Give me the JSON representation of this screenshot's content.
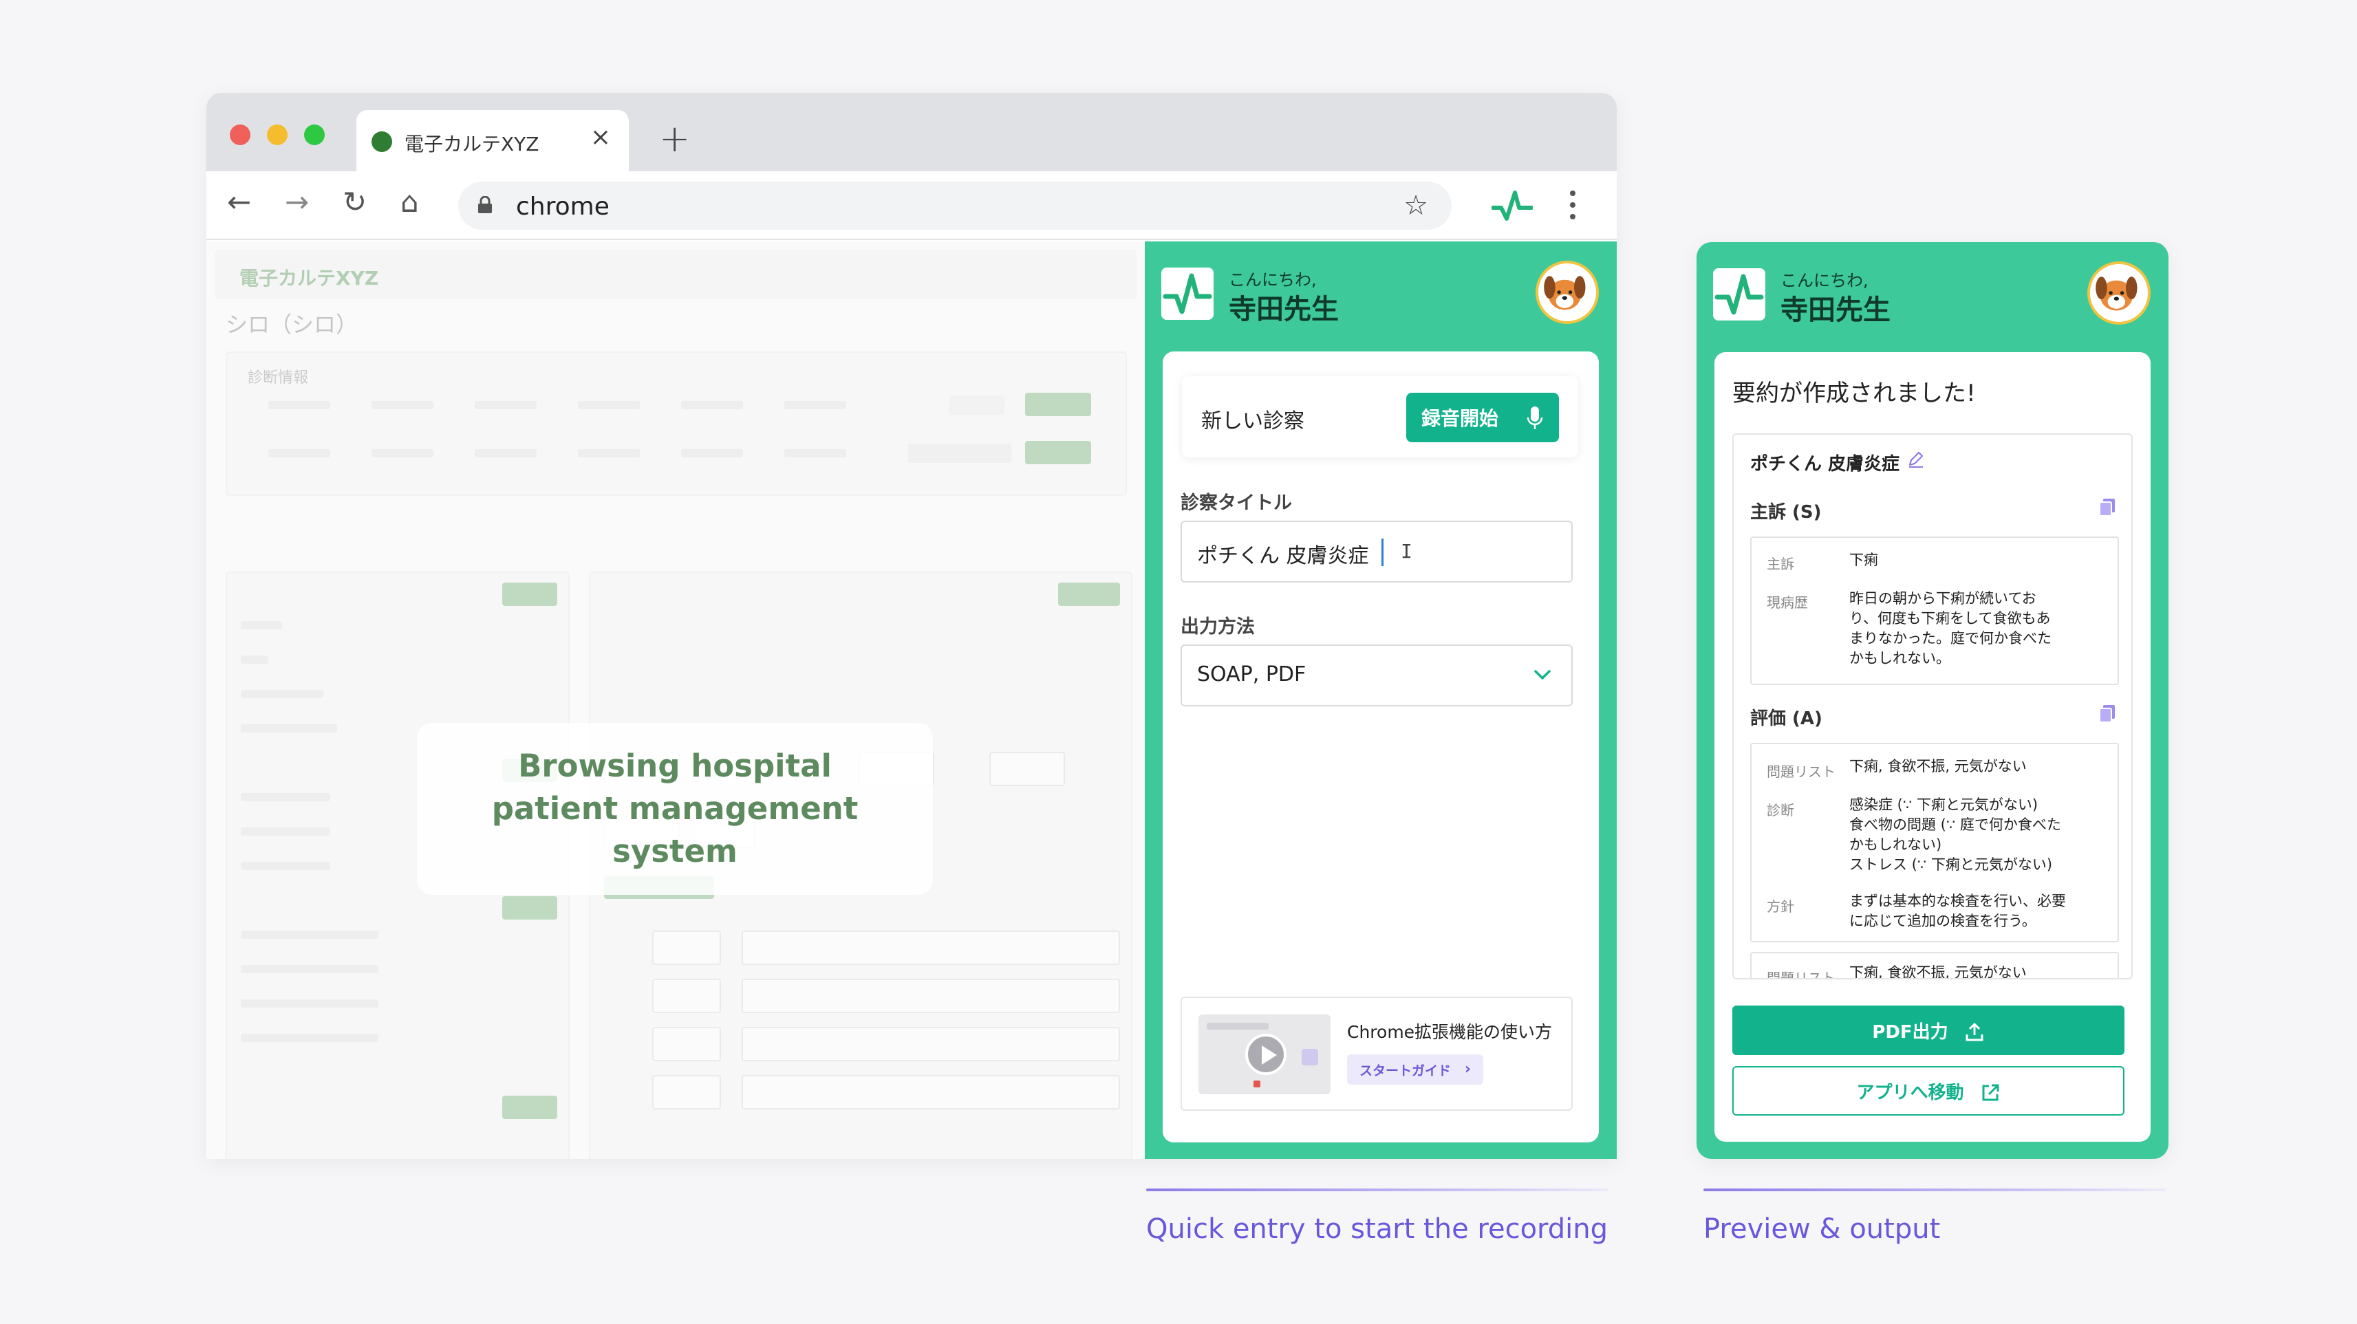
{
  "browser": {
    "tab_title": "電子カルテXYZ",
    "close_glyph": "×",
    "new_tab_glyph": "+",
    "url": "chrome",
    "nav": {
      "back": "←",
      "forward": "→",
      "reload": "↻",
      "home": "⌂",
      "bookmark": "☆"
    }
  },
  "ehr": {
    "brand": "電子カルテXYZ",
    "patient": "シロ（シロ）",
    "section": "診断情報",
    "overlay_text": "Browsing hospital patient management system"
  },
  "sidebar": {
    "greeting": "こんにちわ,",
    "doctor_name": "寺田先生",
    "new_visit_label": "新しい診察",
    "record_button": "録音開始",
    "title_label": "診察タイトル",
    "title_value": "ポチくん 皮膚炎症",
    "output_label": "出力方法",
    "output_value": "SOAP, PDF",
    "guide_title": "Chrome拡張機能の使い方",
    "guide_button": "スタートガイド",
    "guide_chevron": "›"
  },
  "preview": {
    "greeting": "こんにちわ,",
    "doctor_name": "寺田先生",
    "done_title": "要約が作成されました!",
    "case_title": "ポチくん 皮膚炎症",
    "subjective": {
      "title": "主訴 (S)",
      "rows": [
        {
          "key": "主訴",
          "value": "下痢"
        },
        {
          "key": "現病歴",
          "value": "昨日の朝から下痢が続いてお\nり、何度も下痢をして食欲もあ\nまりなかった。庭で何か食べた\nかもしれない。"
        }
      ]
    },
    "assessment": {
      "title": "評価 (A)",
      "rows": [
        {
          "key": "問題リスト",
          "value": "下痢, 食欲不振, 元気がない"
        },
        {
          "key": "診断",
          "value": "感染症 (∵ 下痢と元気がない)\n食べ物の問題 (∵ 庭で何か食べた\nかもしれない)\nストレス (∵ 下痢と元気がない)"
        },
        {
          "key": "方針",
          "value": "まずは基本的な検査を行い、必要\nに応じて追加の検査を行う。"
        }
      ],
      "overflow_key": "問題リスト",
      "overflow_value": "下痢, 食欲不振, 元気がない"
    },
    "pdf_button": "PDF出力",
    "app_button": "アプリへ移動"
  },
  "captions": {
    "left": "Quick entry to start the recording",
    "right": "Preview & output"
  },
  "colors": {
    "brand_green": "#3dc99a",
    "button_green": "#12b38c",
    "caption_purple": "#6957dc"
  },
  "icons": {
    "logo": "pulse-logo-icon",
    "avatar": "dog-avatar-icon",
    "mic": "microphone-icon",
    "copy": "copy-icon",
    "pencil": "pencil-icon",
    "upload": "upload-icon",
    "external": "external-link-icon"
  }
}
